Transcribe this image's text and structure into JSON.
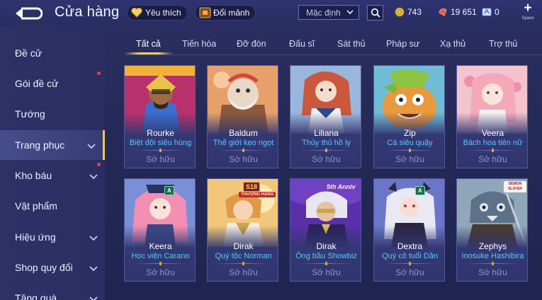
{
  "header": {
    "title": "Cửa hàng",
    "favorites_label": "Yêu thích",
    "exchange_label": "Đổi mảnh",
    "sort_value": "Mặc định",
    "currencies": [
      {
        "name": "gold",
        "value": "743"
      },
      {
        "name": "gem",
        "value": "19 651"
      },
      {
        "name": "voucher",
        "value": "0"
      }
    ],
    "plus_hint": "Space"
  },
  "sidebar": {
    "items": [
      {
        "label": "Đề cử"
      },
      {
        "label": "Gói đề cử"
      },
      {
        "label": "Tướng"
      },
      {
        "label": "Trang phục"
      },
      {
        "label": "Kho báu"
      },
      {
        "label": "Vật phẩm"
      },
      {
        "label": "Hiệu ứng"
      },
      {
        "label": "Shop quy đổi"
      },
      {
        "label": "Tăng quà"
      }
    ]
  },
  "tabs": [
    {
      "label": "Tất cả"
    },
    {
      "label": "Tiến hóa"
    },
    {
      "label": "Đỡ đòn"
    },
    {
      "label": "Đấu sĩ"
    },
    {
      "label": "Sát thủ"
    },
    {
      "label": "Pháp sư"
    },
    {
      "label": "Xạ thủ"
    },
    {
      "label": "Trợ thủ"
    }
  ],
  "cards": [
    {
      "hero": "Rourke",
      "skin": "Biệt đội siêu hùng",
      "status": "Sở hữu"
    },
    {
      "hero": "Baldum",
      "skin": "Thế giới kẹo ngọt",
      "status": "Sở hữu"
    },
    {
      "hero": "Liliana",
      "skin": "Thủy thủ hồ ly",
      "status": "Sở hữu"
    },
    {
      "hero": "Zip",
      "skin": "Cá siêu quậy",
      "status": "Sở hữu"
    },
    {
      "hero": "Veera",
      "skin": "Bách hoa tiên nữ",
      "status": "Sở hữu"
    },
    {
      "hero": "Keera",
      "skin": "Học viện Carano",
      "status": "Sở hữu"
    },
    {
      "hero": "Dirak",
      "skin": "Quý tộc Norman",
      "status": "Sở hữu"
    },
    {
      "hero": "Dirak",
      "skin": "Ông bầu Showbiz",
      "status": "Sở hữu"
    },
    {
      "hero": "Dextra",
      "skin": "Quý cô tuổi Dần",
      "status": "Sở hữu"
    },
    {
      "hero": "Zephys",
      "skin": "Inosuke Hashibira",
      "status": "Sở hữu"
    }
  ],
  "badges": {
    "s18": "S18",
    "s18_sub": "THƯỢNG HẠNG",
    "anniv": "5th Anniv",
    "demon": "DEMON SLAYER",
    "rank_a": "A"
  },
  "colors": {
    "accent_gold": "#f3cf63",
    "skin_name": "#56c8ff",
    "background": "#272b5e",
    "notification": "#ff3b3b"
  }
}
